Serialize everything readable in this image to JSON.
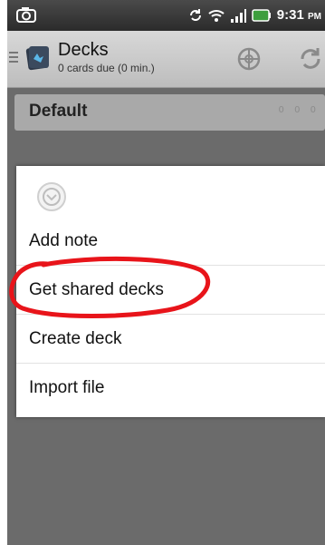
{
  "status_bar": {
    "time": "9:31",
    "ampm": "PM",
    "icons": [
      "camera-icon",
      "sync-icon",
      "wifi-icon",
      "signal-icon",
      "battery-icon"
    ]
  },
  "action_bar": {
    "title": "Decks",
    "subtitle": "0 cards due (0 min.)",
    "icons": [
      "drawer-icon",
      "anki-deck-icon",
      "add-icon",
      "sync-icon"
    ]
  },
  "deck": {
    "name": "Default",
    "counts": "0 0 0"
  },
  "menu": {
    "header_icon": "chevron-down-icon",
    "items": [
      {
        "label": "Add note"
      },
      {
        "label": "Get shared decks"
      },
      {
        "label": "Create deck"
      },
      {
        "label": "Import file"
      }
    ]
  },
  "colors": {
    "screen_dim": "#6b6b6b",
    "annotation_red": "#e8141a",
    "menu_bg": "#ffffff"
  }
}
